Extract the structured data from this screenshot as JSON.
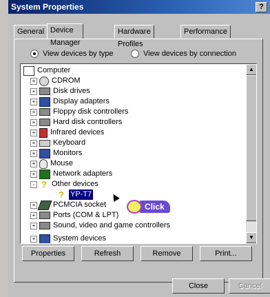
{
  "window": {
    "title": "System Properties",
    "help_label": "?"
  },
  "tabs": [
    "General",
    "Device Manager",
    "Hardware Profiles",
    "Performance"
  ],
  "view_options": {
    "by_type": "View devices by type",
    "by_connection": "View devices by connection",
    "selected": "by_type"
  },
  "tree": {
    "root": "Computer",
    "items": [
      {
        "label": "CDROM",
        "icon": "cdrom-icon",
        "expander": "+"
      },
      {
        "label": "Disk drives",
        "icon": "disk-drive-icon",
        "expander": "+"
      },
      {
        "label": "Display adapters",
        "icon": "display-adapter-icon",
        "expander": "+"
      },
      {
        "label": "Floppy disk controllers",
        "icon": "floppy-controller-icon",
        "expander": "+"
      },
      {
        "label": "Hard disk controllers",
        "icon": "hard-disk-controller-icon",
        "expander": "+"
      },
      {
        "label": "Infrared devices",
        "icon": "infrared-icon",
        "expander": "+"
      },
      {
        "label": "Keyboard",
        "icon": "keyboard-icon",
        "expander": "+"
      },
      {
        "label": "Monitors",
        "icon": "monitor-icon",
        "expander": "+"
      },
      {
        "label": "Mouse",
        "icon": "mouse-icon",
        "expander": "+"
      },
      {
        "label": "Network adapters",
        "icon": "network-adapter-icon",
        "expander": "+"
      },
      {
        "label": "Other devices",
        "icon": "question-mark-icon",
        "expander": "-"
      },
      {
        "label": "YP-T7",
        "icon": "unknown-device-icon",
        "expander": "",
        "child": true,
        "selected": true
      },
      {
        "label": "PCMCIA socket",
        "icon": "pcmcia-icon",
        "expander": "+"
      },
      {
        "label": "Ports (COM & LPT)",
        "icon": "port-icon",
        "expander": "+"
      },
      {
        "label": "Sound, video and game controllers",
        "icon": "sound-icon",
        "expander": "+"
      },
      {
        "label": "System devices",
        "icon": "system-device-icon",
        "expander": "+"
      }
    ]
  },
  "callout": {
    "label": "Click"
  },
  "buttons": {
    "properties": "Properties",
    "refresh": "Refresh",
    "remove": "Remove",
    "print": "Print...",
    "close": "Close",
    "cancel": "Cancel"
  },
  "colors": {
    "title_bar": "#0a246a",
    "selection": "#000080",
    "callout": "#6a4ad0"
  }
}
